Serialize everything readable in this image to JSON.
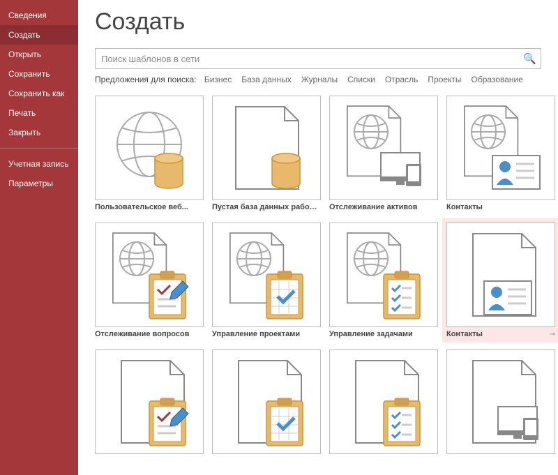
{
  "sidebar": {
    "items": [
      {
        "label": "Сведения",
        "active": false
      },
      {
        "label": "Создать",
        "active": true
      },
      {
        "label": "Открыть",
        "active": false
      },
      {
        "label": "Сохранить",
        "active": false
      },
      {
        "label": "Сохранить как",
        "active": false
      },
      {
        "label": "Печать",
        "active": false
      },
      {
        "label": "Закрыть",
        "active": false
      }
    ],
    "footer": [
      {
        "label": "Учетная запись"
      },
      {
        "label": "Параметры"
      }
    ]
  },
  "page": {
    "title": "Создать"
  },
  "search": {
    "placeholder": "Поиск шаблонов в сети"
  },
  "suggest": {
    "label": "Предложения для поиска:",
    "links": [
      "Бизнес",
      "База данных",
      "Журналы",
      "Списки",
      "Отрасль",
      "Проекты",
      "Образование"
    ]
  },
  "templates": [
    {
      "label": "Пользовательское веб...",
      "icon": "globe-db",
      "highlight": false
    },
    {
      "label": "Пустая база данных рабочего...",
      "icon": "doc-db",
      "highlight": false
    },
    {
      "label": "Отслеживание активов",
      "icon": "globe-devices",
      "highlight": false
    },
    {
      "label": "Контакты",
      "icon": "globe-contact",
      "highlight": false
    },
    {
      "label": "Отслеживание вопросов",
      "icon": "globe-clip-pen",
      "highlight": false
    },
    {
      "label": "Управление проектами",
      "icon": "globe-clip-cal",
      "highlight": false
    },
    {
      "label": "Управление задачами",
      "icon": "globe-clip-check",
      "highlight": false
    },
    {
      "label": "Контакты",
      "icon": "doc-contact",
      "highlight": true
    },
    {
      "label": "",
      "icon": "doc-clip-pen",
      "highlight": false
    },
    {
      "label": "",
      "icon": "doc-clip-cal",
      "highlight": false
    },
    {
      "label": "",
      "icon": "doc-clip-check",
      "highlight": false
    },
    {
      "label": "",
      "icon": "doc-devices",
      "highlight": false
    }
  ]
}
